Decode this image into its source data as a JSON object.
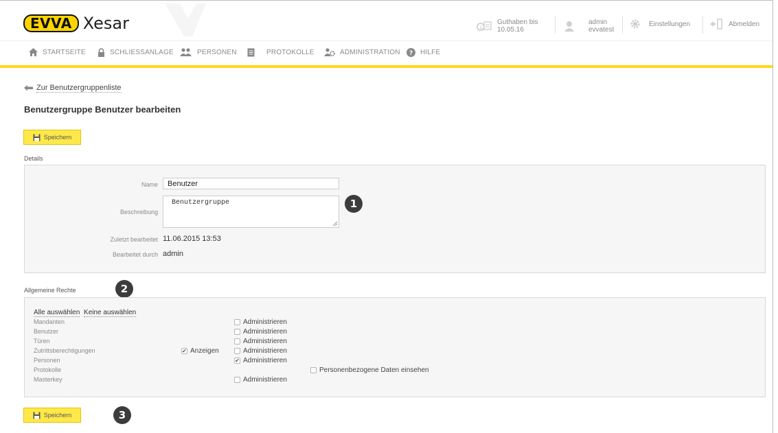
{
  "header": {
    "logo_badge": "EVVA",
    "logo_text": "Xesar",
    "credit": {
      "line1": "Guthaben bis",
      "line2": "10.05.16"
    },
    "user": {
      "line1": "admin",
      "line2": "evvatest"
    },
    "settings_label": "Einstellungen",
    "logout_label": "Abmelden"
  },
  "nav": [
    {
      "label": "STARTSEITE",
      "icon": "home-icon"
    },
    {
      "label": "SCHLIESSANLAGE",
      "icon": "lock-icon"
    },
    {
      "label": "PERSONEN",
      "icon": "people-icon"
    },
    {
      "label": "PROTOKOLLE",
      "icon": "document-icon"
    },
    {
      "label": "ADMINISTRATION",
      "icon": "admin-icon"
    },
    {
      "label": "HILFE",
      "icon": "help-icon"
    }
  ],
  "back_link": "Zur Benutzergruppenliste",
  "page_title": "Benutzergruppe Benutzer bearbeiten",
  "save_label": "Speichern",
  "details": {
    "section_label": "Details",
    "name_label": "Name",
    "name_value": "Benutzer",
    "description_label": "Beschreibung",
    "description_value": "Benutzergruppe",
    "last_edited_label": "Zuletzt bearbeitet",
    "last_edited_value": "11.06.2015 13:53",
    "edited_by_label": "Bearbeitet durch",
    "edited_by_value": "admin"
  },
  "rights": {
    "section_label": "Allgemeine Rechte",
    "select_all": "Alle auswählen",
    "select_none": "Keine auswählen",
    "rows": [
      {
        "label": "Mandanten"
      },
      {
        "label": "Benutzer"
      },
      {
        "label": "Türen"
      },
      {
        "label": "Zutrittsberechtigungen"
      },
      {
        "label": "Personen"
      },
      {
        "label": "Protokolle"
      },
      {
        "label": "Masterkey"
      }
    ],
    "opt_view": "Anzeigen",
    "opt_admin": "Administrieren",
    "opt_personal_data": "Personenbezogene Daten einsehen",
    "view_checked_row": "Zutrittsberechtigungen",
    "admin_checked_row": "Personen"
  },
  "callouts": [
    "1",
    "2",
    "3"
  ],
  "colors": {
    "accent_yellow": "#ffd81a",
    "button_yellow": "#ffe94a",
    "badge_dark": "#3c3c3c"
  }
}
